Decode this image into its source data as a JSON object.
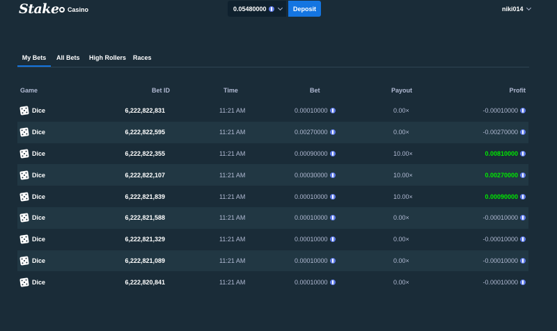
{
  "header": {
    "logo": "Stake",
    "casino_label": "Casino",
    "balance": "0.05480000",
    "deposit_label": "Deposit",
    "username": "niki014"
  },
  "tabs": [
    {
      "label": "My Bets",
      "active": true
    },
    {
      "label": "All Bets",
      "active": false
    },
    {
      "label": "High Rollers",
      "active": false
    },
    {
      "label": "Races",
      "active": false
    }
  ],
  "table": {
    "columns": [
      "Game",
      "Bet ID",
      "Time",
      "Bet",
      "Payout",
      "Profit"
    ],
    "rows": [
      {
        "game": "Dice",
        "bet_id": "6,222,822,831",
        "time": "11:21 AM",
        "bet": "0.00010000",
        "payout": "0.00×",
        "profit": "-0.00010000",
        "win": false
      },
      {
        "game": "Dice",
        "bet_id": "6,222,822,595",
        "time": "11:21 AM",
        "bet": "0.00270000",
        "payout": "0.00×",
        "profit": "-0.00270000",
        "win": false
      },
      {
        "game": "Dice",
        "bet_id": "6,222,822,355",
        "time": "11:21 AM",
        "bet": "0.00090000",
        "payout": "10.00×",
        "profit": "0.00810000",
        "win": true
      },
      {
        "game": "Dice",
        "bet_id": "6,222,822,107",
        "time": "11:21 AM",
        "bet": "0.00030000",
        "payout": "10.00×",
        "profit": "0.00270000",
        "win": true
      },
      {
        "game": "Dice",
        "bet_id": "6,222,821,839",
        "time": "11:21 AM",
        "bet": "0.00010000",
        "payout": "10.00×",
        "profit": "0.00090000",
        "win": true
      },
      {
        "game": "Dice",
        "bet_id": "6,222,821,588",
        "time": "11:21 AM",
        "bet": "0.00010000",
        "payout": "0.00×",
        "profit": "-0.00010000",
        "win": false
      },
      {
        "game": "Dice",
        "bet_id": "6,222,821,329",
        "time": "11:21 AM",
        "bet": "0.00010000",
        "payout": "0.00×",
        "profit": "-0.00010000",
        "win": false
      },
      {
        "game": "Dice",
        "bet_id": "6,222,821,089",
        "time": "11:21 AM",
        "bet": "0.00010000",
        "payout": "0.00×",
        "profit": "-0.00010000",
        "win": false
      },
      {
        "game": "Dice",
        "bet_id": "6,222,820,841",
        "time": "11:21 AM",
        "bet": "0.00010000",
        "payout": "0.00×",
        "profit": "-0.00010000",
        "win": false
      }
    ]
  },
  "icons": {
    "currency": "eth-coin-icon",
    "game": "dice-icon"
  },
  "colors": {
    "background": "#1a2c38",
    "row_alt": "#213743",
    "accent": "#1475e1",
    "win": "#00e701",
    "muted_text": "#b1bad3"
  }
}
